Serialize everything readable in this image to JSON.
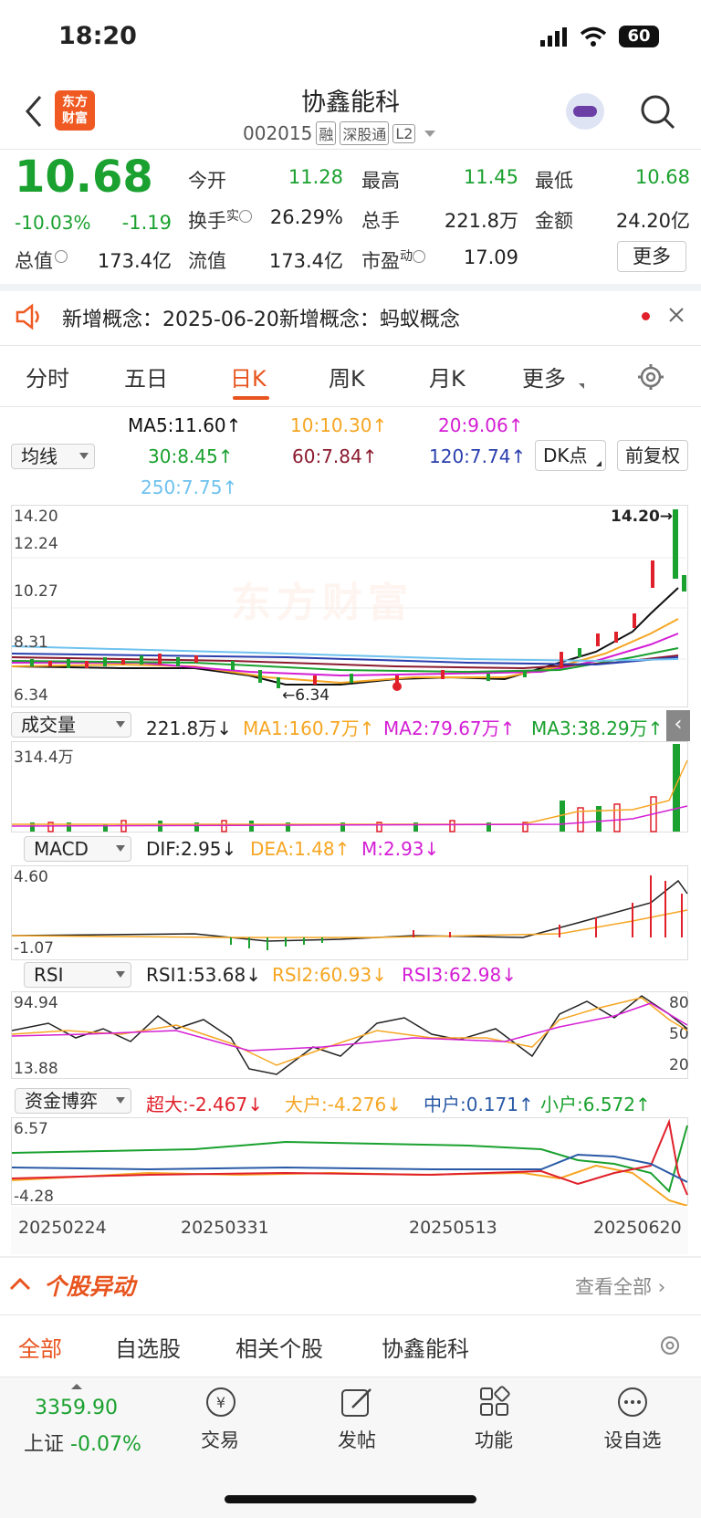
{
  "status": {
    "time": "18:20",
    "battery": "60"
  },
  "header": {
    "logo_line1": "东方",
    "logo_line2": "财富",
    "name": "协鑫能科",
    "code": "002015",
    "badges": [
      "融",
      "深股通",
      "L2"
    ]
  },
  "quote": {
    "price": "10.68",
    "pct": "-10.03%",
    "chg": "-1.19",
    "open_label": "今开",
    "open": "11.28",
    "high_label": "最高",
    "high": "11.45",
    "low_label": "最低",
    "low": "10.68",
    "turnover_label": "换手",
    "turnover_sup": "实",
    "turnover": "26.29%",
    "vol_label": "总手",
    "vol": "221.8万",
    "amount_label": "金额",
    "amount": "24.20亿",
    "mktcap_label": "总值",
    "mktcap": "173.4亿",
    "float_label": "流值",
    "float": "173.4亿",
    "pe_label": "市盈",
    "pe_sup": "动",
    "pe": "17.09",
    "more": "更多"
  },
  "notice": {
    "text": "新增概念：2025-06-20新增概念：蚂蚁概念"
  },
  "tabs": [
    "分时",
    "五日",
    "日K",
    "周K",
    "月K",
    "更多"
  ],
  "active_tab": "日K",
  "ma": {
    "select": "均线",
    "ma5": "MA5:11.60↑",
    "ma10": "10:10.30↑",
    "ma20": "20:9.06↑",
    "ma30": "30:8.45↑",
    "ma60": "60:7.84↑",
    "ma120": "120:7.74↑",
    "ma250": "250:7.75↑",
    "dk": "DK点",
    "fq": "前复权"
  },
  "kline": {
    "y_ticks": [
      "14.20",
      "12.24",
      "10.27",
      "8.31",
      "6.34"
    ],
    "high_mark": "14.20",
    "low_mark": "6.34",
    "watermark": "东方财富"
  },
  "volume": {
    "select": "成交量",
    "v": "221.8万↓",
    "ma1": "MA1:160.7万↑",
    "ma2": "MA2:79.67万↑",
    "ma3": "MA3:38.29万↑",
    "top": "314.4万"
  },
  "macd": {
    "select": "MACD",
    "dif": "DIF:2.95↓",
    "dea": "DEA:1.48↑",
    "m": "M:2.93↓",
    "top": "4.60",
    "bottom": "-1.07"
  },
  "rsi": {
    "select": "RSI",
    "r1": "RSI1:53.68↓",
    "r2": "RSI2:60.93↓",
    "r3": "RSI3:62.98↓",
    "top": "94.94",
    "bottom": "13.88",
    "l80": "80",
    "l50": "50",
    "l20": "20"
  },
  "fund": {
    "select": "资金博弈",
    "super": "超大:-2.467↓",
    "big": "大户:-4.276↓",
    "mid": "中户:0.171↑",
    "small": "小户:6.572↑",
    "top": "6.57",
    "bottom": "-4.28"
  },
  "dates": [
    "20250224",
    "20250331",
    "20250513",
    "20250620"
  ],
  "movers": {
    "title": "个股异动",
    "view_all": "查看全部"
  },
  "sub_tabs": [
    "全部",
    "自选股",
    "相关个股",
    "协鑫能科"
  ],
  "bottom_nav": {
    "index_value": "3359.90",
    "index_name": "上证",
    "index_pct": "-0.07%",
    "items": [
      "交易",
      "发帖",
      "功能",
      "设自选"
    ]
  }
}
